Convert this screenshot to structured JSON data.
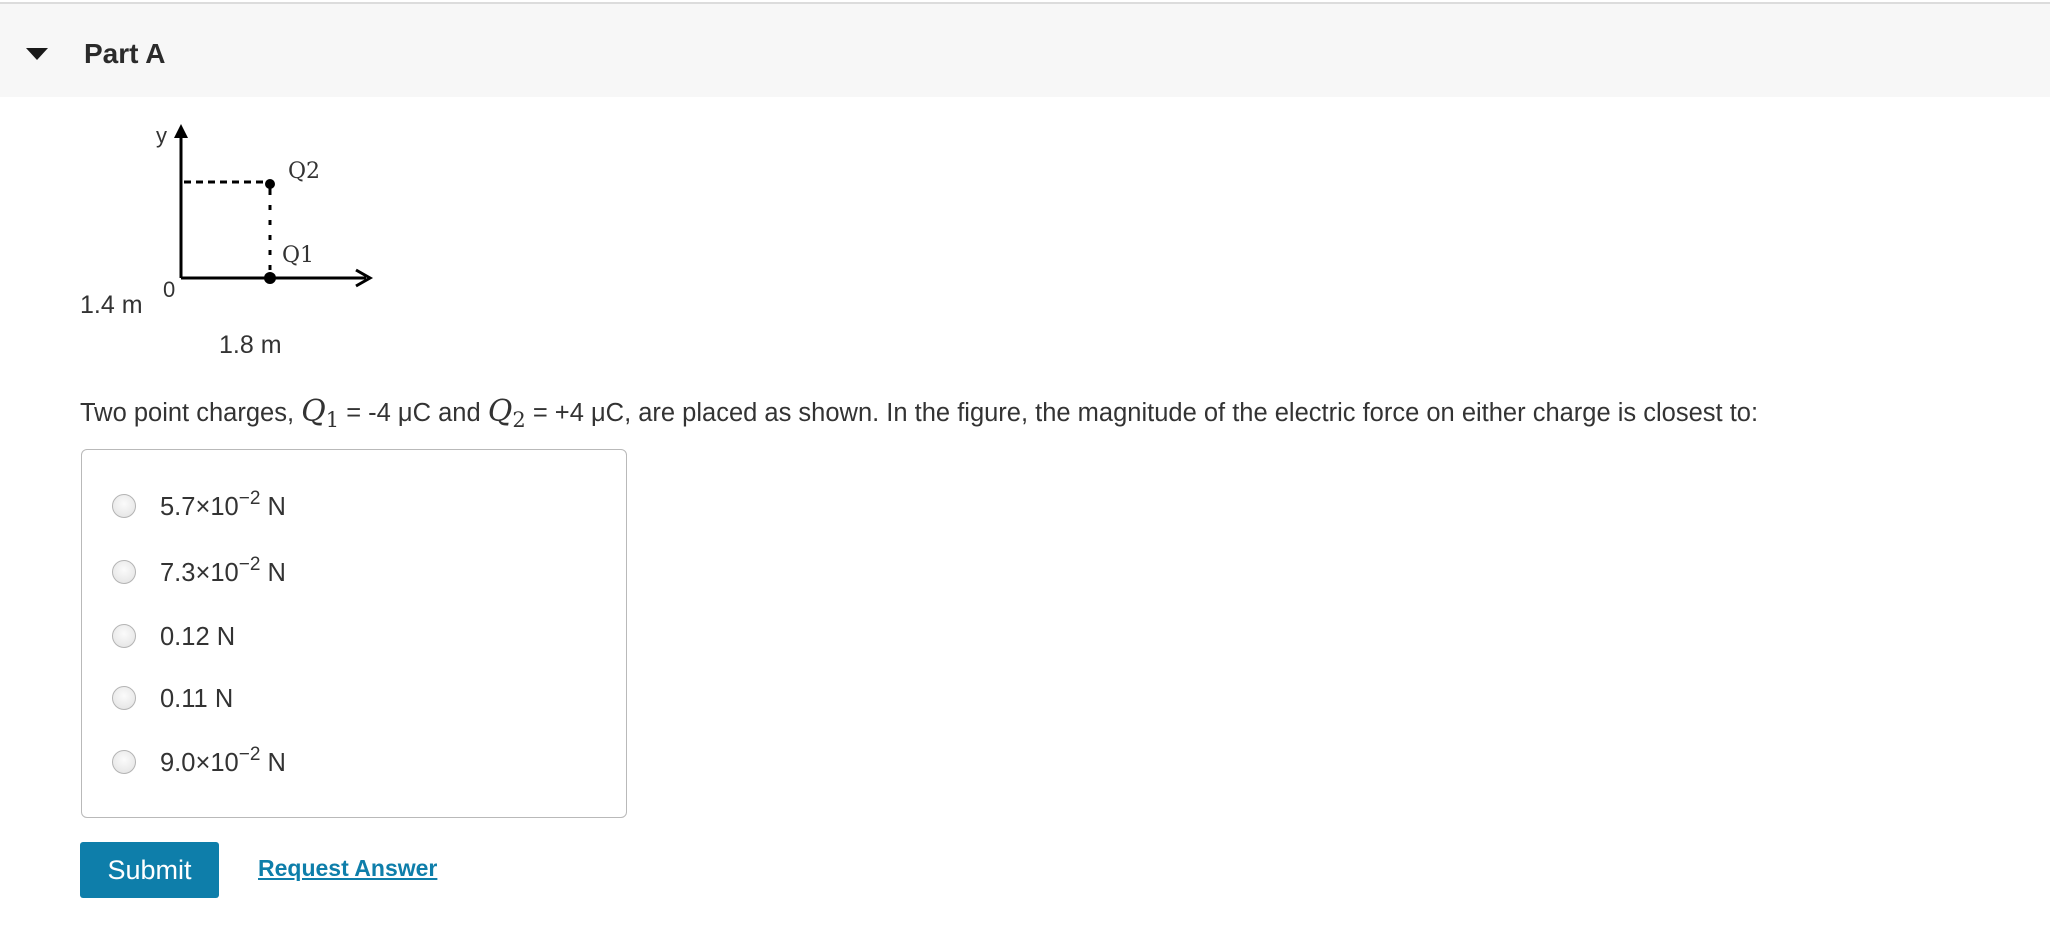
{
  "part": {
    "title": "Part A"
  },
  "figure": {
    "y_axis_label": "y",
    "origin_label": "0",
    "q2_label": "Q2",
    "q1_label": "Q1",
    "vertical_distance": "1.4 m",
    "horizontal_distance": "1.8 m"
  },
  "question": {
    "intro": "Two point charges, ",
    "q1_symbol": "Q",
    "q1_sub": "1",
    "q1_value": " = -4 μC and ",
    "q2_symbol": "Q",
    "q2_sub": "2",
    "q2_value": " = +4 μC, are placed as shown. In the figure, the magnitude of the electric force on either charge is closest to:"
  },
  "choices": [
    {
      "base": "5.7×10",
      "exp": "−2",
      "unit": " N"
    },
    {
      "base": "7.3×10",
      "exp": "−2",
      "unit": " N"
    },
    {
      "base": "0.12 N",
      "exp": "",
      "unit": ""
    },
    {
      "base": "0.11 N",
      "exp": "",
      "unit": ""
    },
    {
      "base": "9.0×10",
      "exp": "−2",
      "unit": " N"
    }
  ],
  "actions": {
    "submit_label": "Submit",
    "request_answer_label": "Request Answer"
  },
  "colors": {
    "accent": "#0e7eaa",
    "header_bg": "#f7f7f7",
    "text": "#333333"
  },
  "icons": {
    "part_toggle": "caret-down-icon"
  }
}
